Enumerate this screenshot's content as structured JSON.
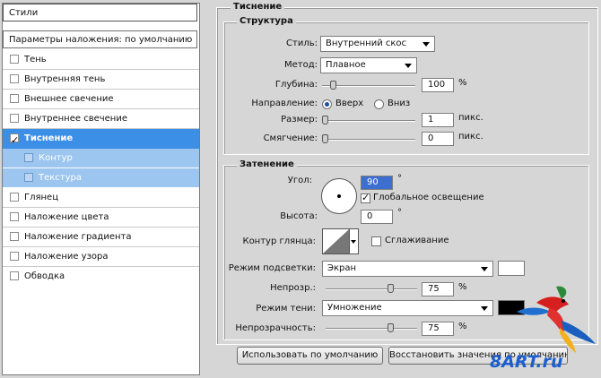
{
  "left_panel": {
    "title": "Стили",
    "blending_default": "Параметры наложения: по умолчанию",
    "items": [
      {
        "label": "Тень",
        "checked": false
      },
      {
        "label": "Внутренняя тень",
        "checked": false
      },
      {
        "label": "Внешнее свечение",
        "checked": false
      },
      {
        "label": "Внутреннее свечение",
        "checked": false
      },
      {
        "label": "Тиснение",
        "checked": true
      },
      {
        "label": "Контур",
        "checked": false
      },
      {
        "label": "Текстура",
        "checked": false
      },
      {
        "label": "Глянец",
        "checked": false
      },
      {
        "label": "Наложение цвета",
        "checked": false
      },
      {
        "label": "Наложение градиента",
        "checked": false
      },
      {
        "label": "Наложение узора",
        "checked": false
      },
      {
        "label": "Обводка",
        "checked": false
      }
    ]
  },
  "emboss": {
    "title": "Тиснение",
    "structure": {
      "title": "Структура",
      "style_label": "Стиль:",
      "style_value": "Внутренний скос",
      "method_label": "Метод:",
      "method_value": "Плавное",
      "depth_label": "Глубина:",
      "depth_value": "100",
      "depth_unit": "%",
      "direction_label": "Направление:",
      "direction_up": "Вверх",
      "direction_down": "Вниз",
      "size_label": "Размер:",
      "size_value": "1",
      "size_unit": "пикс.",
      "soften_label": "Смягчение:",
      "soften_value": "0",
      "soften_unit": "пикс."
    },
    "shading": {
      "title": "Затенение",
      "angle_label": "Угол:",
      "angle_value": "90",
      "degree": "°",
      "global_light_label": "Глобальное освещение",
      "altitude_label": "Высота:",
      "altitude_value": "0",
      "gloss_label": "Контур глянца:",
      "antialias_label": "Сглаживание",
      "highlight_mode_label": "Режим подсветки:",
      "highlight_mode_value": "Экран",
      "highlight_color": "#ffffff",
      "highlight_opacity_label": "Непрозр.:",
      "highlight_opacity_value": "75",
      "shadow_mode_label": "Режим тени:",
      "shadow_mode_value": "Умножение",
      "shadow_color": "#000000",
      "shadow_opacity_label": "Непрозрачность:",
      "shadow_opacity_value": "75",
      "percent": "%"
    },
    "buttons": {
      "make_default": "Использовать по умолчанию",
      "reset_default": "Восстановить значения по умолчанию"
    }
  },
  "watermark": "8ART.ru"
}
